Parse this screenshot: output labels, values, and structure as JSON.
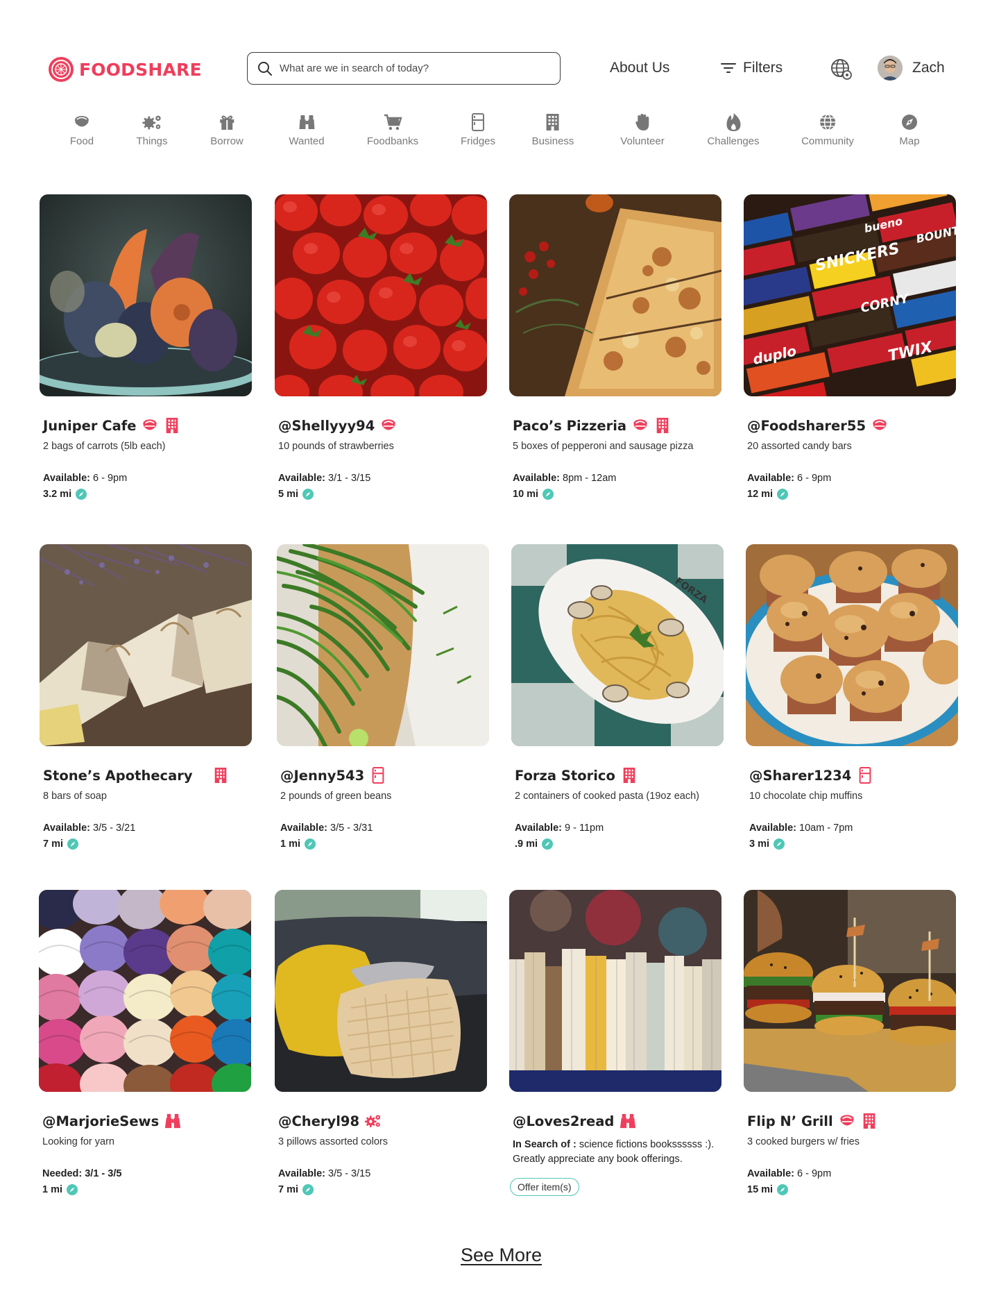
{
  "brand": {
    "name": "FOODSHARE",
    "color": "#ef3e5c"
  },
  "search": {
    "placeholder": "What are we in search of today?"
  },
  "header": {
    "about_label": "About Us",
    "filters_label": "Filters",
    "user_name": "Zach"
  },
  "categories": [
    {
      "label": "Food",
      "icon": "food-bowl-icon"
    },
    {
      "label": "Things",
      "icon": "gears-icon"
    },
    {
      "label": "Borrow",
      "icon": "gift-icon"
    },
    {
      "label": "Wanted",
      "icon": "binoculars-icon"
    },
    {
      "label": "Foodbanks",
      "icon": "cart-icon"
    },
    {
      "label": "Fridges",
      "icon": "fridge-icon"
    },
    {
      "label": "Business",
      "icon": "building-icon"
    },
    {
      "label": "Volunteer",
      "icon": "hand-icon"
    },
    {
      "label": "Challenges",
      "icon": "flame-icon"
    },
    {
      "label": "Community",
      "icon": "globe-icon"
    },
    {
      "label": "Map",
      "icon": "compass-icon"
    }
  ],
  "listings": [
    {
      "title": "Juniper Cafe",
      "badges": [
        "food-bowl-icon",
        "building-icon"
      ],
      "description": "2 bags of carrots (5lb each)",
      "avail_label": "Available:",
      "avail_value": "6 - 9pm",
      "distance": "3.2 mi",
      "image": "carrots"
    },
    {
      "title": "@Shellyyy94",
      "badges": [
        "food-bowl-icon"
      ],
      "description": "10 pounds of strawberries",
      "avail_label": "Available:",
      "avail_value": "3/1 - 3/15",
      "distance": "5 mi",
      "image": "strawberries"
    },
    {
      "title": "Paco’s Pizzeria",
      "badges": [
        "food-bowl-icon",
        "building-icon"
      ],
      "description": "5 boxes of pepperoni and sausage pizza",
      "avail_label": "Available:",
      "avail_value": "8pm - 12am",
      "distance": "10 mi",
      "image": "pizza"
    },
    {
      "title": "@Foodsharer55",
      "badges": [
        "food-bowl-icon"
      ],
      "description": "20 assorted candy bars",
      "avail_label": "Available:",
      "avail_value": "6 - 9pm",
      "distance": "12 mi",
      "image": "candy"
    },
    {
      "title": "Stone’s Apothecary",
      "badges": [
        "building-icon"
      ],
      "description": "8 bars of soap",
      "avail_label": "Available:",
      "avail_value": "3/5 - 3/21",
      "distance": "7 mi",
      "image": "soap"
    },
    {
      "title": "@Jenny543",
      "badges": [
        "fridge-icon"
      ],
      "description": "2 pounds of green beans",
      "avail_label": "Available:",
      "avail_value": "3/5 - 3/31",
      "distance": "1 mi",
      "image": "beans"
    },
    {
      "title": "Forza Storico",
      "badges": [
        "building-icon"
      ],
      "description": "2 containers of cooked pasta (19oz each)",
      "avail_label": "Available:",
      "avail_value": "9 - 11pm",
      "distance": ".9 mi",
      "image": "pasta"
    },
    {
      "title": "@Sharer1234",
      "badges": [
        "fridge-icon"
      ],
      "description": "10 chocolate chip muffins",
      "avail_label": "Available:",
      "avail_value": "10am - 7pm",
      "distance": "3 mi",
      "image": "muffins"
    },
    {
      "title": "@MarjorieSews",
      "badges": [
        "binoculars-icon"
      ],
      "description": "Looking for yarn",
      "avail_label": "Needed: 3/1 - 3/5",
      "avail_value": "",
      "distance": "1 mi",
      "image": "yarn"
    },
    {
      "title": "@Cheryl98",
      "badges": [
        "gears-icon"
      ],
      "description": "3 pillows assorted colors",
      "avail_label": "Available:",
      "avail_value": "3/5 - 3/15",
      "distance": "7 mi",
      "image": "pillows"
    },
    {
      "title": "@Loves2read",
      "badges": [
        "binoculars-icon"
      ],
      "search_label": "In Search of :",
      "search_text": "science fictions bookssssss :).",
      "search_text_2": "Greatly appreciate any book offerings.",
      "offer_label": "Offer item(s)",
      "image": "books"
    },
    {
      "title": "Flip N’ Grill",
      "badges": [
        "food-bowl-icon",
        "building-icon"
      ],
      "description": "3 cooked burgers w/ fries",
      "avail_label": "Available:",
      "avail_value": "6 - 9pm",
      "distance": "15 mi",
      "image": "burgers"
    }
  ],
  "see_more_label": "See More",
  "colors": {
    "accent": "#ef3e5c",
    "teal": "#4fc7b6",
    "muted": "#7a7a7a"
  }
}
